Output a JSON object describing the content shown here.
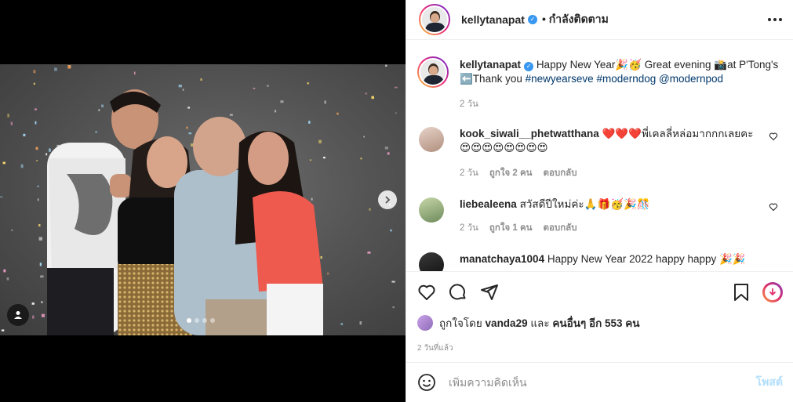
{
  "post": {
    "username": "kellytanapat",
    "follow_status": "• กำลังติดตาม"
  },
  "caption": {
    "username": "kellytanapat",
    "text1": "Happy New Year🎉🥳 Great evening 📸at P'Tong's",
    "text2": "⬅️Thank you",
    "tag1": "#newyearseve",
    "tag2": "#moderndog",
    "mention": "@modernpod",
    "time": "2 วัน"
  },
  "comments": [
    {
      "username": "kook_siwali__phetwatthana",
      "text": "❤️❤️❤️พี่เคลลี่หล่อมากกกเลยคะ",
      "text2": "😍😍😍😍😍😍😍😍",
      "time": "2 วัน",
      "likes": "ถูกใจ 2 คน",
      "reply": "ตอบกลับ"
    },
    {
      "username": "liebealeena",
      "text": "สวัสดีปีใหม่ค่ะ🙏🎁🥳🎉🎊",
      "time": "2 วัน",
      "likes": "ถูกใจ 1 คน",
      "reply": "ตอบกลับ"
    },
    {
      "username": "manatchaya1004",
      "text": "Happy New Year 2022 happy happy 🎉🎉"
    }
  ],
  "likes": {
    "prefix": "ถูกใจโดย",
    "user": "vanda29",
    "conj": "และ",
    "others": "คนอื่นๆ อีก 553 คน"
  },
  "posted_ago": "2 วันที่แล้ว",
  "comment_box": {
    "placeholder": "เพิ่มความคิดเห็น",
    "post_label": "โพสต์"
  },
  "carousel": {
    "slides": 4,
    "active": 1
  }
}
